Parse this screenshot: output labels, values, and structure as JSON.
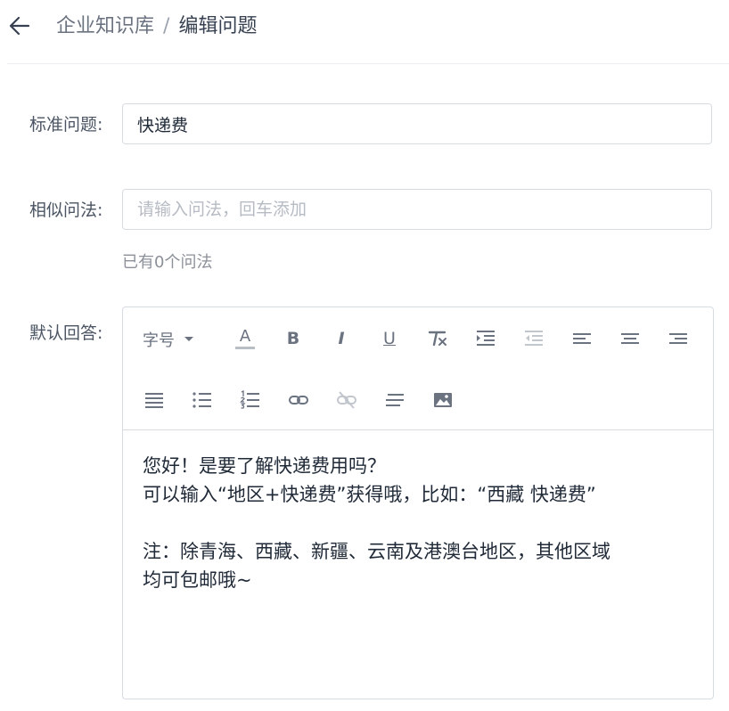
{
  "header": {
    "breadcrumb_parent": "企业知识库",
    "breadcrumb_separator": "/",
    "breadcrumb_current": "编辑问题"
  },
  "form": {
    "standard_question_label": "标准问题:",
    "standard_question_value": "快递费",
    "similar_label": "相似问法:",
    "similar_placeholder": "请输入问法，回车添加",
    "similar_count_hint": "已有0个问法",
    "answer_label": "默认回答:"
  },
  "toolbar": {
    "font_size_label": "字号",
    "font_color_letter": "A",
    "bold_letter": "B",
    "italic_letter": "I",
    "underline_letter": "U"
  },
  "answer": {
    "line1": "您好！是要了解快递费用吗？",
    "line2": "可以输入“地区+快递费”获得哦，比如：“西藏 快递费”",
    "line3": "注：除青海、西藏、新疆、云南及港澳台地区，其他区域",
    "line4": "均可包邮哦~"
  },
  "colors": {
    "text": "#1f2937",
    "border": "#d7dbe2",
    "muted": "#6b7280",
    "disabled_icon": "#c2c6cd"
  }
}
